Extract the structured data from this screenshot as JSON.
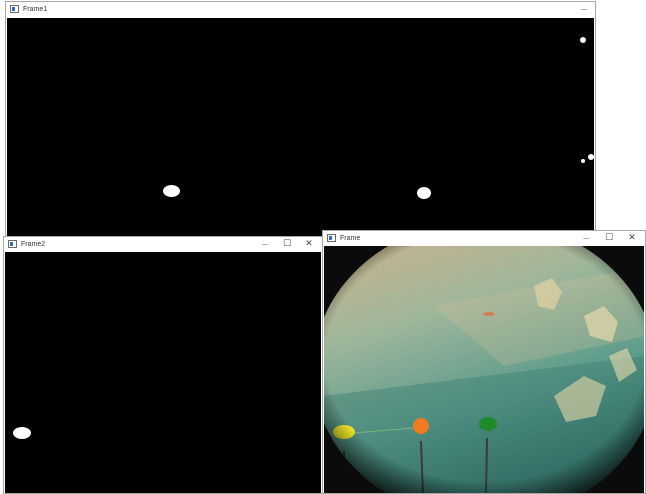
{
  "windows": {
    "frame1": {
      "title": "Frame1",
      "controls": {
        "minimize": "—"
      }
    },
    "frame2": {
      "title": "Frame2",
      "controls": {
        "minimize": "—",
        "maximize": "☐",
        "close": "✕"
      }
    },
    "frame": {
      "title": "Frame",
      "controls": {
        "minimize": "—",
        "maximize": "☐",
        "close": "✕"
      }
    }
  },
  "colors": {
    "mask_background": "#000000",
    "mask_blob": "#ffffff",
    "marker_yellow": "#f2e82a",
    "marker_orange": "#f07a1e",
    "marker_green": "#1e8a2a"
  },
  "icons": {
    "window_icon": "app-window-icon"
  }
}
